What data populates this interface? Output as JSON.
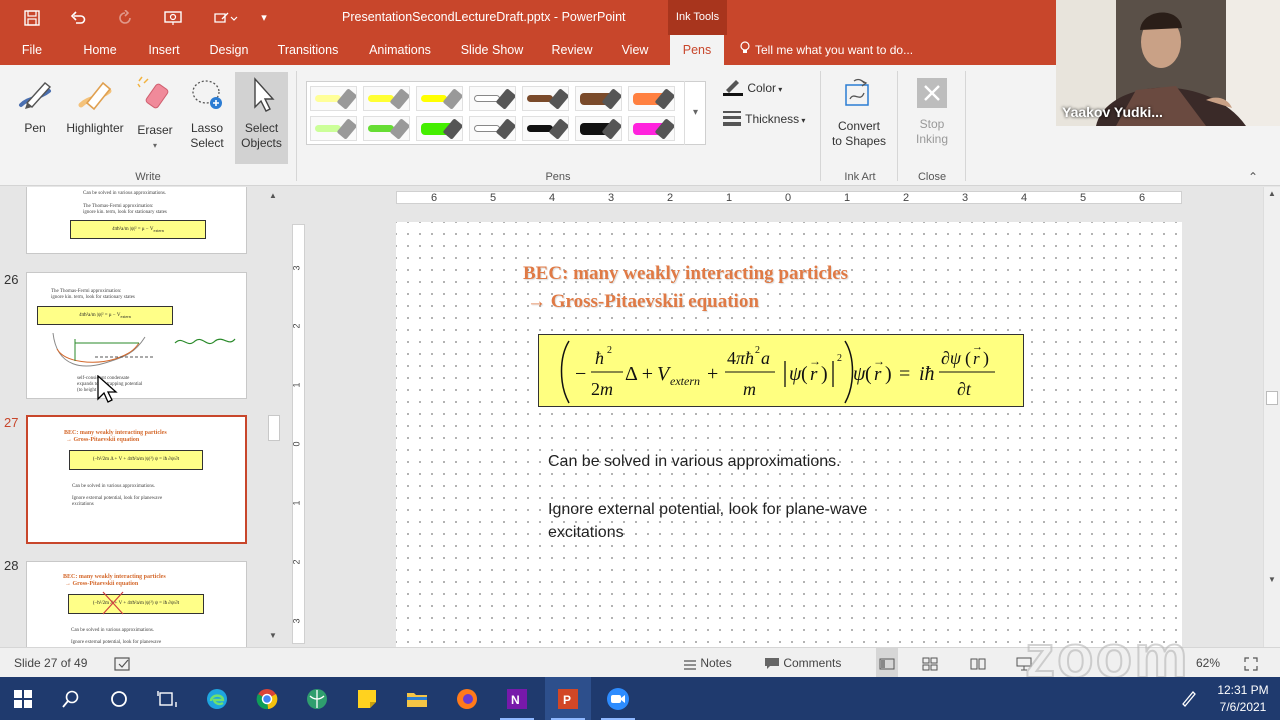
{
  "window": {
    "title": "PresentationSecondLectureDraft.pptx - PowerPoint",
    "context_tab": "Ink Tools",
    "accent": "#c8462b"
  },
  "qat": [
    "save-icon",
    "undo-icon",
    "redo-icon",
    "presentation-from-start-icon",
    "touch-mode-icon",
    "customize-icon"
  ],
  "tabs": [
    "File",
    "Home",
    "Insert",
    "Design",
    "Transitions",
    "Animations",
    "Slide Show",
    "Review",
    "View",
    "Pens"
  ],
  "active_tab": "Pens",
  "tellme": "Tell me what you want to do...",
  "ribbon": {
    "write": {
      "label": "Write",
      "pen": "Pen",
      "highlighter": "Highlighter",
      "eraser": "Eraser",
      "lasso_line1": "Lasso",
      "lasso_line2": "Select",
      "select_line1": "Select",
      "select_line2": "Objects"
    },
    "pens": {
      "label": "Pens",
      "color": "Color",
      "thickness": "Thickness"
    },
    "inkart": {
      "label": "Ink Art",
      "convert_line1": "Convert",
      "convert_line2": "to Shapes"
    },
    "close": {
      "label": "Close",
      "stop_line1": "Stop",
      "stop_line2": "Inking"
    },
    "pen_swatches": [
      {
        "color": "#ffff99",
        "type": "highlighter"
      },
      {
        "color": "#ffff33",
        "type": "highlighter"
      },
      {
        "color": "#ffff00",
        "type": "highlighter"
      },
      {
        "color": "#ffffff",
        "type": "pen"
      },
      {
        "color": "#7a4a2a",
        "type": "pen"
      },
      {
        "color": "#7a4a2a",
        "type": "marker"
      },
      {
        "color": "#ff8040",
        "type": "marker"
      },
      {
        "color": "#ccff99",
        "type": "highlighter"
      },
      {
        "color": "#66dd33",
        "type": "highlighter"
      },
      {
        "color": "#44ee00",
        "type": "marker"
      },
      {
        "color": "#ffffff",
        "type": "pen"
      },
      {
        "color": "#111111",
        "type": "pen"
      },
      {
        "color": "#111111",
        "type": "marker"
      },
      {
        "color": "#ff22dd",
        "type": "marker"
      }
    ]
  },
  "thumbnails": [
    {
      "num": "26",
      "title": "",
      "lines": [
        "The Thomas-Fermi approximation:",
        "ignore kin. term, look for stationary states",
        "self-consistent condensate",
        "expands to fill trapping potential",
        "(to height ..."
      ]
    },
    {
      "num": "27",
      "title_l1": "BEC: many weakly interacting particles",
      "title_l2": "→ Gross-Pitaevskii equation",
      "lines": [
        "Can be solved in various approximations.",
        "Ignore external potential,  look for planewave",
        "excitations"
      ]
    },
    {
      "num": "28",
      "title_l1": "BEC: many weakly interacting particles",
      "title_l2": "→ Gross-Pitaevskii equation",
      "lines": [
        "Can be solved in various approximations.",
        "Ignore external potential,  look for planewave"
      ]
    }
  ],
  "thumb_prev_lines": [
    "Can be solved in various approximations.",
    "The Thomas-Fermi approximation:",
    "ignore kin. term, look for stationary states"
  ],
  "slide": {
    "title_l1": "BEC: many weakly interacting particles",
    "title_l2": "→ Gross-Pitaevskii equation",
    "equation": "(−ħ²/2m Δ + V_extern + 4πħ²a/m |ψ(r)|²) ψ(r) = iħ ∂ψ(r)/∂t",
    "text1": "Can be solved in various approximations.",
    "text2_l1": "Ignore external potential,  look for plane-wave",
    "text2_l2": "excitations"
  },
  "ruler": {
    "h_numbers": [
      "6",
      "5",
      "4",
      "3",
      "2",
      "1",
      "0",
      "1",
      "2",
      "3",
      "4",
      "5",
      "6"
    ],
    "v_numbers": [
      "3",
      "2",
      "1",
      "0",
      "1",
      "2",
      "3"
    ]
  },
  "status": {
    "slide": "Slide 27 of 49",
    "notes": "Notes",
    "comments": "Comments",
    "zoom": "62%"
  },
  "webcam": {
    "name": "Yaakov Yudki..."
  },
  "watermark": "zoom",
  "taskbar": {
    "apps": [
      "windows-start-icon",
      "search-icon",
      "cortana-icon",
      "task-view-icon",
      "edge-icon",
      "chrome-icon",
      "app-icon",
      "sticky-notes-icon",
      "file-explorer-icon",
      "firefox-icon",
      "onenote-icon",
      "powerpoint-icon",
      "zoom-icon"
    ],
    "time": "12:31 PM",
    "date": "7/6/2021"
  }
}
